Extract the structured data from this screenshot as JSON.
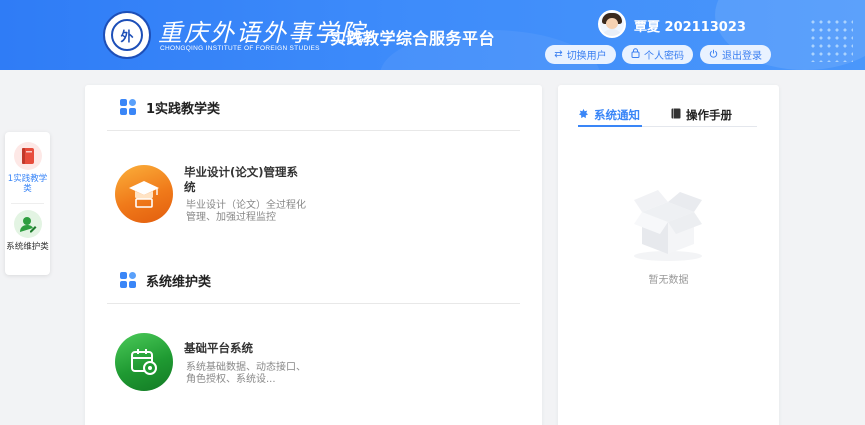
{
  "header": {
    "logo_seal_text": "外",
    "logo_cn": "重庆外语外事学院",
    "logo_en": "CHONGQING INSTITUTE OF FOREIGN STUDIES",
    "platform_title": "实践教学综合服务平台",
    "username": "覃夏  202113023",
    "buttons": {
      "switch_user": "切换用户",
      "personal_password": "个人密码",
      "logout": "退出登录"
    },
    "accent_color": "#3a86f7"
  },
  "sidenav": {
    "items": [
      {
        "label": "1实践教学类",
        "icon": "book-icon",
        "active": true
      },
      {
        "label": "系统维护类",
        "icon": "user-edit-icon",
        "active": false
      }
    ]
  },
  "main": {
    "sections": [
      {
        "title": "1实践教学类",
        "apps": [
          {
            "title": "毕业设计(论文)管理系统",
            "desc": "毕业设计（论文）全过程化管理、加强过程监控",
            "icon": "graduation-cap-icon"
          }
        ]
      },
      {
        "title": "系统维护类",
        "apps": [
          {
            "title": "基础平台系统",
            "desc": "系统基础数据、动态接口、角色授权、系统设...",
            "icon": "calendar-gear-icon"
          }
        ]
      }
    ]
  },
  "right": {
    "tabs": [
      {
        "label": "系统通知",
        "icon": "notice-icon",
        "active": true
      },
      {
        "label": "操作手册",
        "icon": "manual-icon",
        "active": false
      }
    ],
    "empty_text": "暂无数据"
  }
}
